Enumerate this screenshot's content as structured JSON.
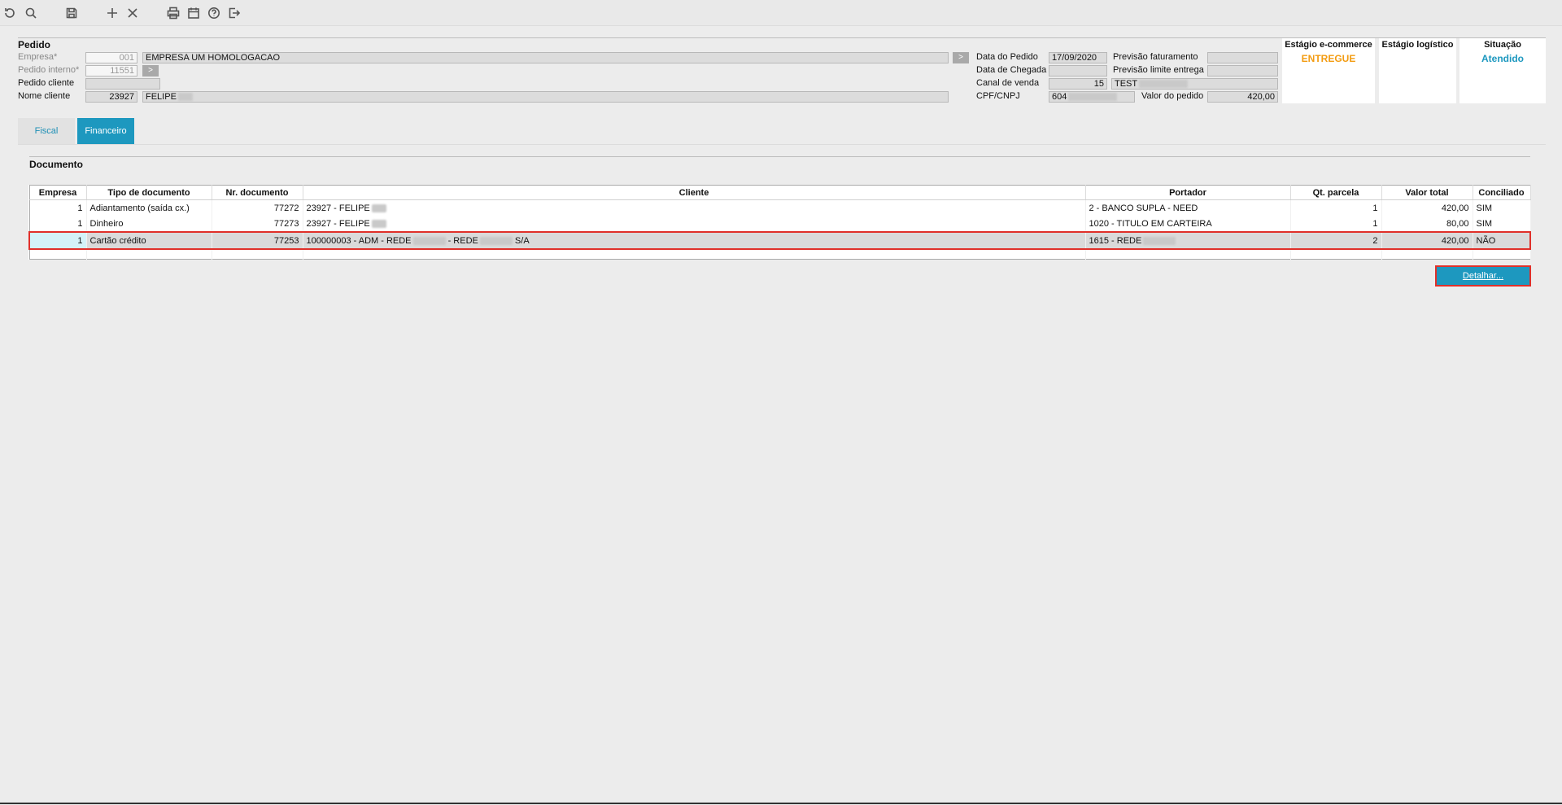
{
  "toolbar": {
    "icons": [
      "refresh-icon",
      "search-icon",
      "save-icon",
      "add-icon",
      "close-icon",
      "print-icon",
      "calendar-icon",
      "help-icon",
      "exit-icon"
    ]
  },
  "pedido": {
    "section_title": "Pedido",
    "empresa_label": "Empresa*",
    "empresa_code": "001",
    "empresa_name": "EMPRESA UM HOMOLOGACAO",
    "pedido_interno_label": "Pedido interno*",
    "pedido_interno_value": "11551",
    "pedido_cliente_label": "Pedido cliente",
    "pedido_cliente_value": "",
    "nome_cliente_label": "Nome cliente",
    "nome_cliente_code": "23927",
    "nome_cliente_name": "FELIPE"
  },
  "datas": {
    "data_pedido_label": "Data do Pedido",
    "data_pedido_value": "17/09/2020",
    "data_chegada_label": "Data de Chegada",
    "data_chegada_value": "",
    "canal_venda_label": "Canal de venda",
    "canal_venda_code": "15",
    "canal_venda_name": "TEST",
    "cpf_label": "CPF/CNPJ",
    "cpf_value": "604",
    "previsao_faturamento_label": "Previsão faturamento",
    "previsao_faturamento_value": "",
    "previsao_limite_label": "Previsão limite entrega",
    "previsao_limite_value": "",
    "valor_pedido_label": "Valor do pedido",
    "valor_pedido_value": "420,00"
  },
  "stages": {
    "ecommerce_title": "Estágio e-commerce",
    "ecommerce_value": "ENTREGUE",
    "ecommerce_color": "#f39c12",
    "logistico_title": "Estágio logístico",
    "logistico_value": "",
    "situacao_title": "Situação",
    "situacao_value": "Atendido",
    "situacao_color": "#1d98bf"
  },
  "tabs": [
    {
      "label": "Fiscal",
      "active": false
    },
    {
      "label": "Financeiro",
      "active": true
    }
  ],
  "documento": {
    "title": "Documento",
    "columns": [
      "Empresa",
      "Tipo de documento",
      "Nr. documento",
      "Cliente",
      "Portador",
      "Qt. parcela",
      "Valor total",
      "Conciliado"
    ],
    "rows": [
      {
        "empresa": "1",
        "tipo": "Adiantamento (saída cx.)",
        "nr": "77272",
        "cliente": "23927 - FELIPE",
        "portador": "2 - BANCO SUPLA - NEED",
        "qt": "1",
        "valor": "420,00",
        "conciliado": "SIM"
      },
      {
        "empresa": "1",
        "tipo": "Dinheiro",
        "nr": "77273",
        "cliente": "23927 - FELIPE",
        "portador": "1020 - TITULO EM CARTEIRA",
        "qt": "1",
        "valor": "80,00",
        "conciliado": "SIM"
      },
      {
        "empresa": "1",
        "tipo": "Cartão crédito",
        "nr": "77253",
        "cliente_a": "100000003 - ADM - REDE",
        "cliente_b": "- REDE",
        "cliente_c": "S/A",
        "portador": "1615 - REDE",
        "qt": "2",
        "valor": "420,00",
        "conciliado": "NÃO"
      }
    ],
    "detail_button": "Detalhar..."
  }
}
